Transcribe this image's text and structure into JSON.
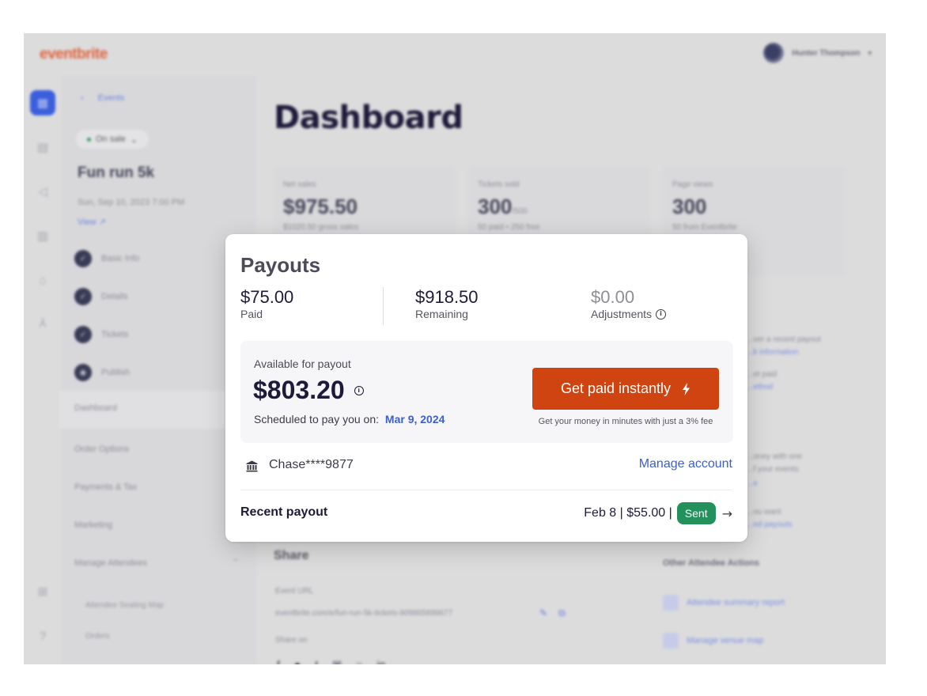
{
  "app": {
    "logo": "eventbrite",
    "user_name": "Hunter Thompson",
    "rail_icons": [
      "calendar-icon",
      "orders-icon",
      "megaphone-icon",
      "chart-icon",
      "bank-icon",
      "network-icon",
      "apps-icon",
      "help-icon"
    ]
  },
  "sidebar": {
    "back_label": "Events",
    "status": "On sale",
    "event_title": "Fun run 5k",
    "event_date": "Sun, Sep 10, 2023 7:00 PM",
    "view_label": "View",
    "steps": [
      {
        "label": "Basic Info",
        "state": "done"
      },
      {
        "label": "Details",
        "state": "done"
      },
      {
        "label": "Tickets",
        "state": "done"
      },
      {
        "label": "Publish",
        "state": "current"
      }
    ],
    "nav_items": [
      "Dashboard",
      "Order Options",
      "Payments & Tax",
      "Marketing",
      "Manage Attendees"
    ],
    "sub_items": [
      "Attendee Seating Map",
      "Orders"
    ]
  },
  "main": {
    "page_title": "Dashboard",
    "stats": [
      {
        "label": "Net sales",
        "value": "$975.50",
        "suffix": "",
        "sub": "$1020.50 gross sales"
      },
      {
        "label": "Tickets sold",
        "value": "300",
        "suffix": "/500",
        "sub": "50 paid • 250 free"
      },
      {
        "label": "Page views",
        "value": "300",
        "suffix": "",
        "sub": "50 from Eventbrite"
      }
    ],
    "right_panel": {
      "texts": [
        "...ver a recent payout",
        "...k information",
        "...et paid",
        "...ethod",
        "...oney with one",
        "...f your events",
        "...e",
        "...ou want",
        "...ed payouts"
      ],
      "other_heading": "Other Attendee Actions",
      "actions": [
        "Attendee summary report",
        "Manage venue map"
      ]
    },
    "share": {
      "title": "Share",
      "url_label": "Event URL",
      "url": "eventbrite.com/e/fun-run-5k-tickets-909865899677",
      "share_on_label": "Share on"
    }
  },
  "modal": {
    "title": "Payouts",
    "summary": [
      {
        "value": "$75.00",
        "label": "Paid"
      },
      {
        "value": "$918.50",
        "label": "Remaining"
      },
      {
        "value": "$0.00",
        "label": "Adjustments"
      }
    ],
    "available": {
      "label": "Available for payout",
      "amount": "$803.20",
      "scheduled_label": "Scheduled to pay you on:",
      "scheduled_date": "Mar 9, 2024"
    },
    "instant_button": "Get paid instantly",
    "fee_note": "Get your money in minutes with just a 3% fee",
    "account": {
      "name": "Chase****9877",
      "manage_label": "Manage account"
    },
    "recent": {
      "label": "Recent payout",
      "info": "Feb 8 | $55.00 |",
      "status": "Sent"
    },
    "colors": {
      "primary_button": "#cf4410",
      "link": "#3d5fc8",
      "success": "#22915c"
    }
  }
}
